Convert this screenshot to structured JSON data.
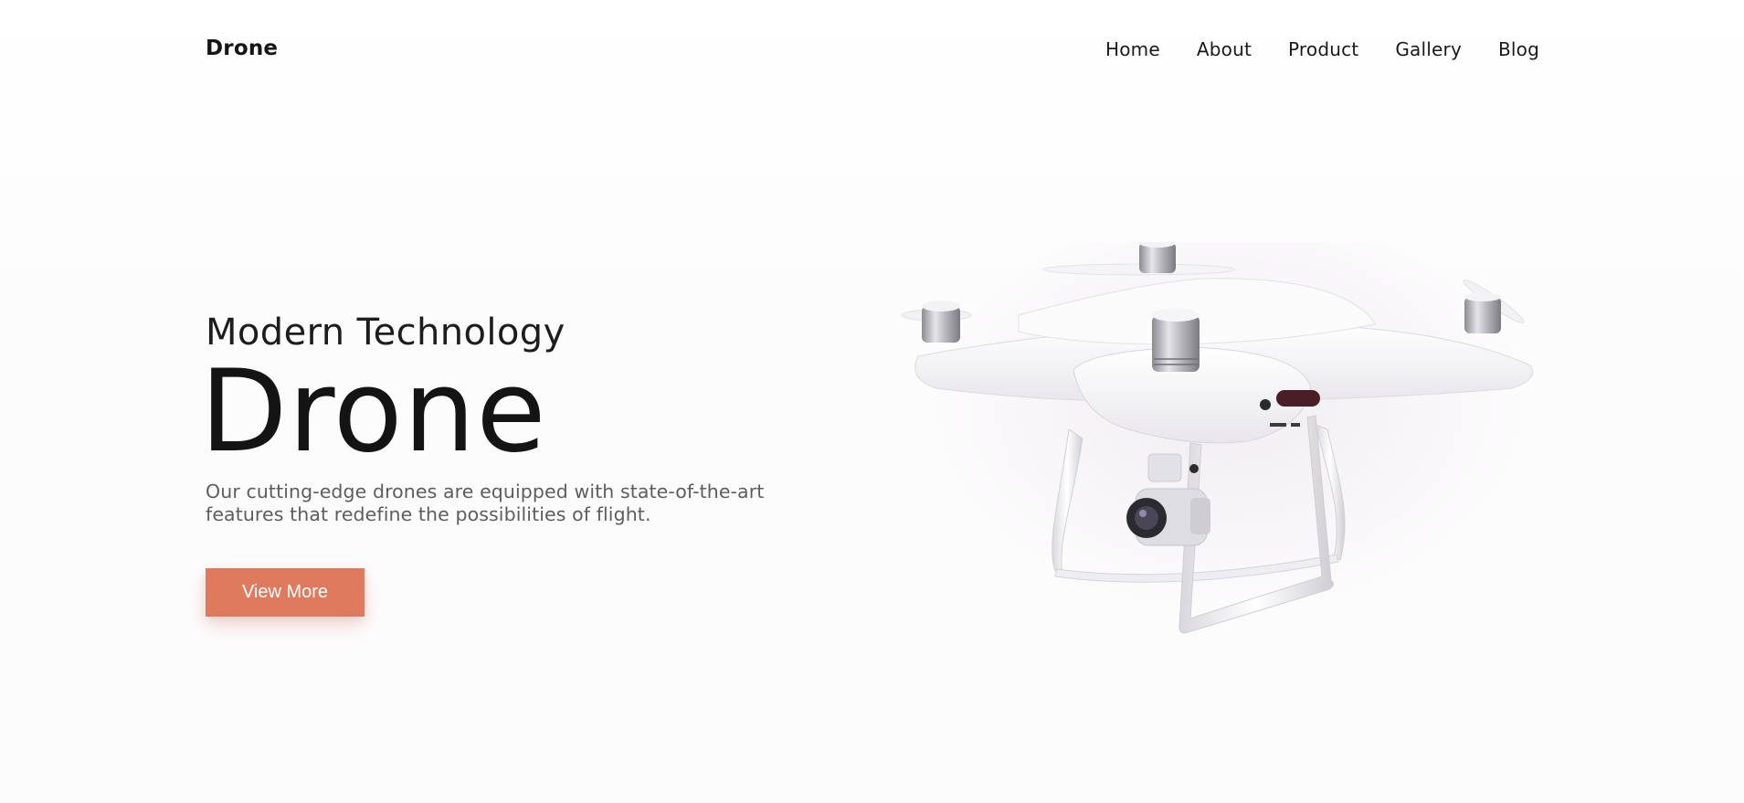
{
  "navbar": {
    "brand": "Drone",
    "links": [
      "Home",
      "About",
      "Product",
      "Gallery",
      "Blog"
    ]
  },
  "hero": {
    "subtitle": "Modern Technology",
    "title": "Drone",
    "description": "Our cutting-edge drones are equipped with state-of-the-art features that redefine the possibilities of flight.",
    "button_label": "View More",
    "image": "drone-photo"
  },
  "colors": {
    "accent": "#e07a5f",
    "text_dark": "#141414",
    "text_muted": "#5d5d5d",
    "background": "#fdfcfd"
  }
}
